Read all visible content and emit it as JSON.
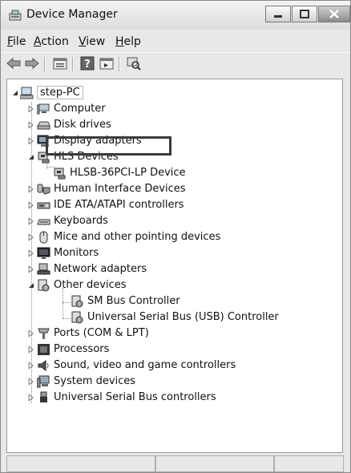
{
  "window": {
    "title": "Device Manager"
  },
  "menu": [
    {
      "accel": "F",
      "rest": "ile"
    },
    {
      "accel": "A",
      "rest": "ction"
    },
    {
      "accel": "V",
      "rest": "iew"
    },
    {
      "accel": "H",
      "rest": "elp"
    }
  ],
  "toolbar": [
    "back-icon",
    "forward-icon",
    "properties-icon",
    "help-icon",
    "show-hidden-icon",
    "scan-hardware-icon"
  ],
  "tree": {
    "root": "step-PC",
    "items": [
      {
        "label": "Computer",
        "icon": "computer-icon"
      },
      {
        "label": "Disk drives",
        "icon": "disk-drive-icon"
      },
      {
        "label": "Display adapters",
        "icon": "display-adapter-icon"
      },
      {
        "label": "HLS Devices",
        "icon": "hls-device-icon"
      },
      {
        "label": "HLSB-36PCI-LP Device",
        "icon": "hls-device-icon"
      },
      {
        "label": "Human Interface Devices",
        "icon": "hid-icon"
      },
      {
        "label": "IDE ATA/ATAPI controllers",
        "icon": "ide-controller-icon"
      },
      {
        "label": "Keyboards",
        "icon": "keyboard-icon"
      },
      {
        "label": "Mice and other pointing devices",
        "icon": "mouse-icon"
      },
      {
        "label": "Monitors",
        "icon": "monitor-icon"
      },
      {
        "label": "Network adapters",
        "icon": "network-adapter-icon"
      },
      {
        "label": "Other devices",
        "icon": "unknown-device-icon"
      },
      {
        "label": "SM Bus Controller",
        "icon": "unknown-device-icon"
      },
      {
        "label": "Universal Serial Bus (USB) Controller",
        "icon": "unknown-device-icon"
      },
      {
        "label": "Ports (COM & LPT)",
        "icon": "port-icon"
      },
      {
        "label": "Processors",
        "icon": "processor-icon"
      },
      {
        "label": "Sound, video and game controllers",
        "icon": "sound-icon"
      },
      {
        "label": "System devices",
        "icon": "system-device-icon"
      },
      {
        "label": "Universal Serial Bus controllers",
        "icon": "usb-icon"
      }
    ]
  },
  "colors": {
    "window_bg": "#e8e8e8",
    "tree_bg": "#ffffff",
    "highlight_border": "#3a3a3a"
  }
}
